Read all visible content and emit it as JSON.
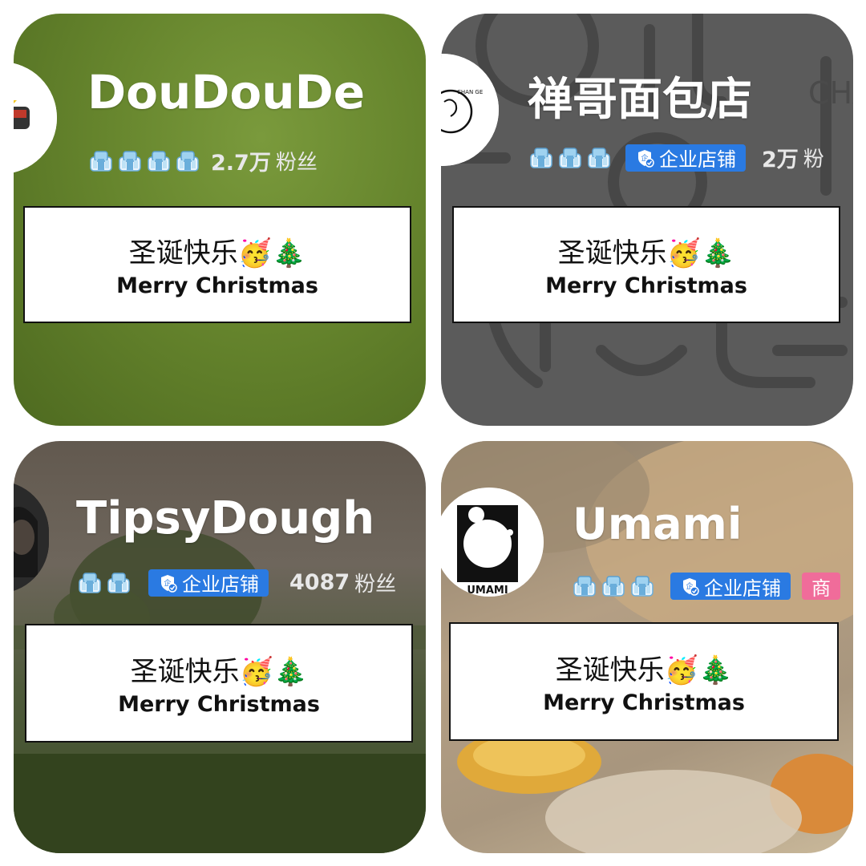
{
  "cards": [
    {
      "name": "DouDouDe",
      "crowns": 4,
      "fans_value": "2.7万",
      "fans_label": "粉丝",
      "greeting_cn": "圣诞快乐🥳🎄",
      "greeting_en": "Merry Christmas"
    },
    {
      "name": "禅哥面包店",
      "avatar_text": "CHAN GE",
      "bg_text": "CHAN GE",
      "crowns": 3,
      "badge": "企业店铺",
      "fans_value": "2万",
      "fans_label": "粉",
      "greeting_cn": "圣诞快乐🥳🎄",
      "greeting_en": "Merry Christmas"
    },
    {
      "name": "TipsyDough",
      "crowns": 2,
      "badge": "企业店铺",
      "fans_value": "4087",
      "fans_label": "粉丝",
      "greeting_cn": "圣诞快乐🥳🎄",
      "greeting_en": "Merry Christmas"
    },
    {
      "name": "Umami",
      "avatar_text": "UMAMI",
      "crowns": 3,
      "badge": "企业店铺",
      "badge2": "商",
      "greeting_cn": "圣诞快乐🥳🎄",
      "greeting_en": "Merry Christmas"
    }
  ],
  "colors": {
    "badge_blue": "#2a7ae2",
    "badge_pink": "#f06c9a",
    "crown": "#8fc8ec"
  }
}
